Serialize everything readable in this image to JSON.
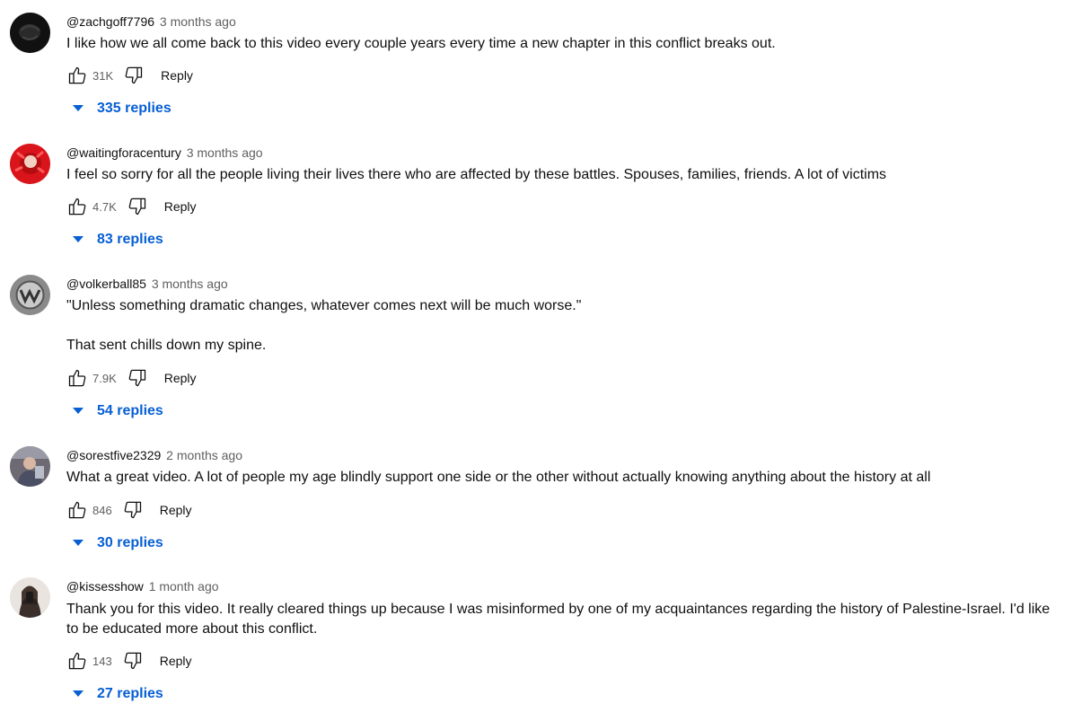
{
  "comments": [
    {
      "author": "@zachgoff7796",
      "time": "3 months ago",
      "text": "I like how we all come back to this video every couple years every time a new chapter in this conflict breaks out.",
      "likes": "31K",
      "reply_label": "Reply",
      "replies_label": "335 replies",
      "avatar_icon": "dark-avatar"
    },
    {
      "author": "@waitingforacentury",
      "time": "3 months ago",
      "text": "I feel so sorry for all the people living their lives there who are affected by these battles. Spouses, families, friends. A lot of victims",
      "likes": "4.7K",
      "reply_label": "Reply",
      "replies_label": "83 replies",
      "avatar_icon": "red-avatar"
    },
    {
      "author": "@volkerball85",
      "time": "3 months ago",
      "text": "\"Unless something dramatic changes, whatever comes next will be much worse.\"\n\nThat sent chills down my spine.",
      "likes": "7.9K",
      "reply_label": "Reply",
      "replies_label": "54 replies",
      "avatar_icon": "gray-logo-avatar"
    },
    {
      "author": "@sorestfive2329",
      "time": "2 months ago",
      "text": "What a great video. A lot of people my age blindly support one side or the other without actually knowing anything about the history at all",
      "likes": "846",
      "reply_label": "Reply",
      "replies_label": "30 replies",
      "avatar_icon": "photo-avatar"
    },
    {
      "author": "@kissesshow",
      "time": "1 month ago",
      "text": "Thank you for this video. It really cleared things up because I was misinformed by one of my acquaintances regarding the history of Palestine-Israel. I'd like to be educated more about this conflict.",
      "likes": "143",
      "reply_label": "Reply",
      "replies_label": "27 replies",
      "avatar_icon": "selfie-avatar"
    }
  ],
  "colors": {
    "link_blue": "#065fd4",
    "meta_gray": "#606060",
    "text": "#0f0f0f"
  }
}
